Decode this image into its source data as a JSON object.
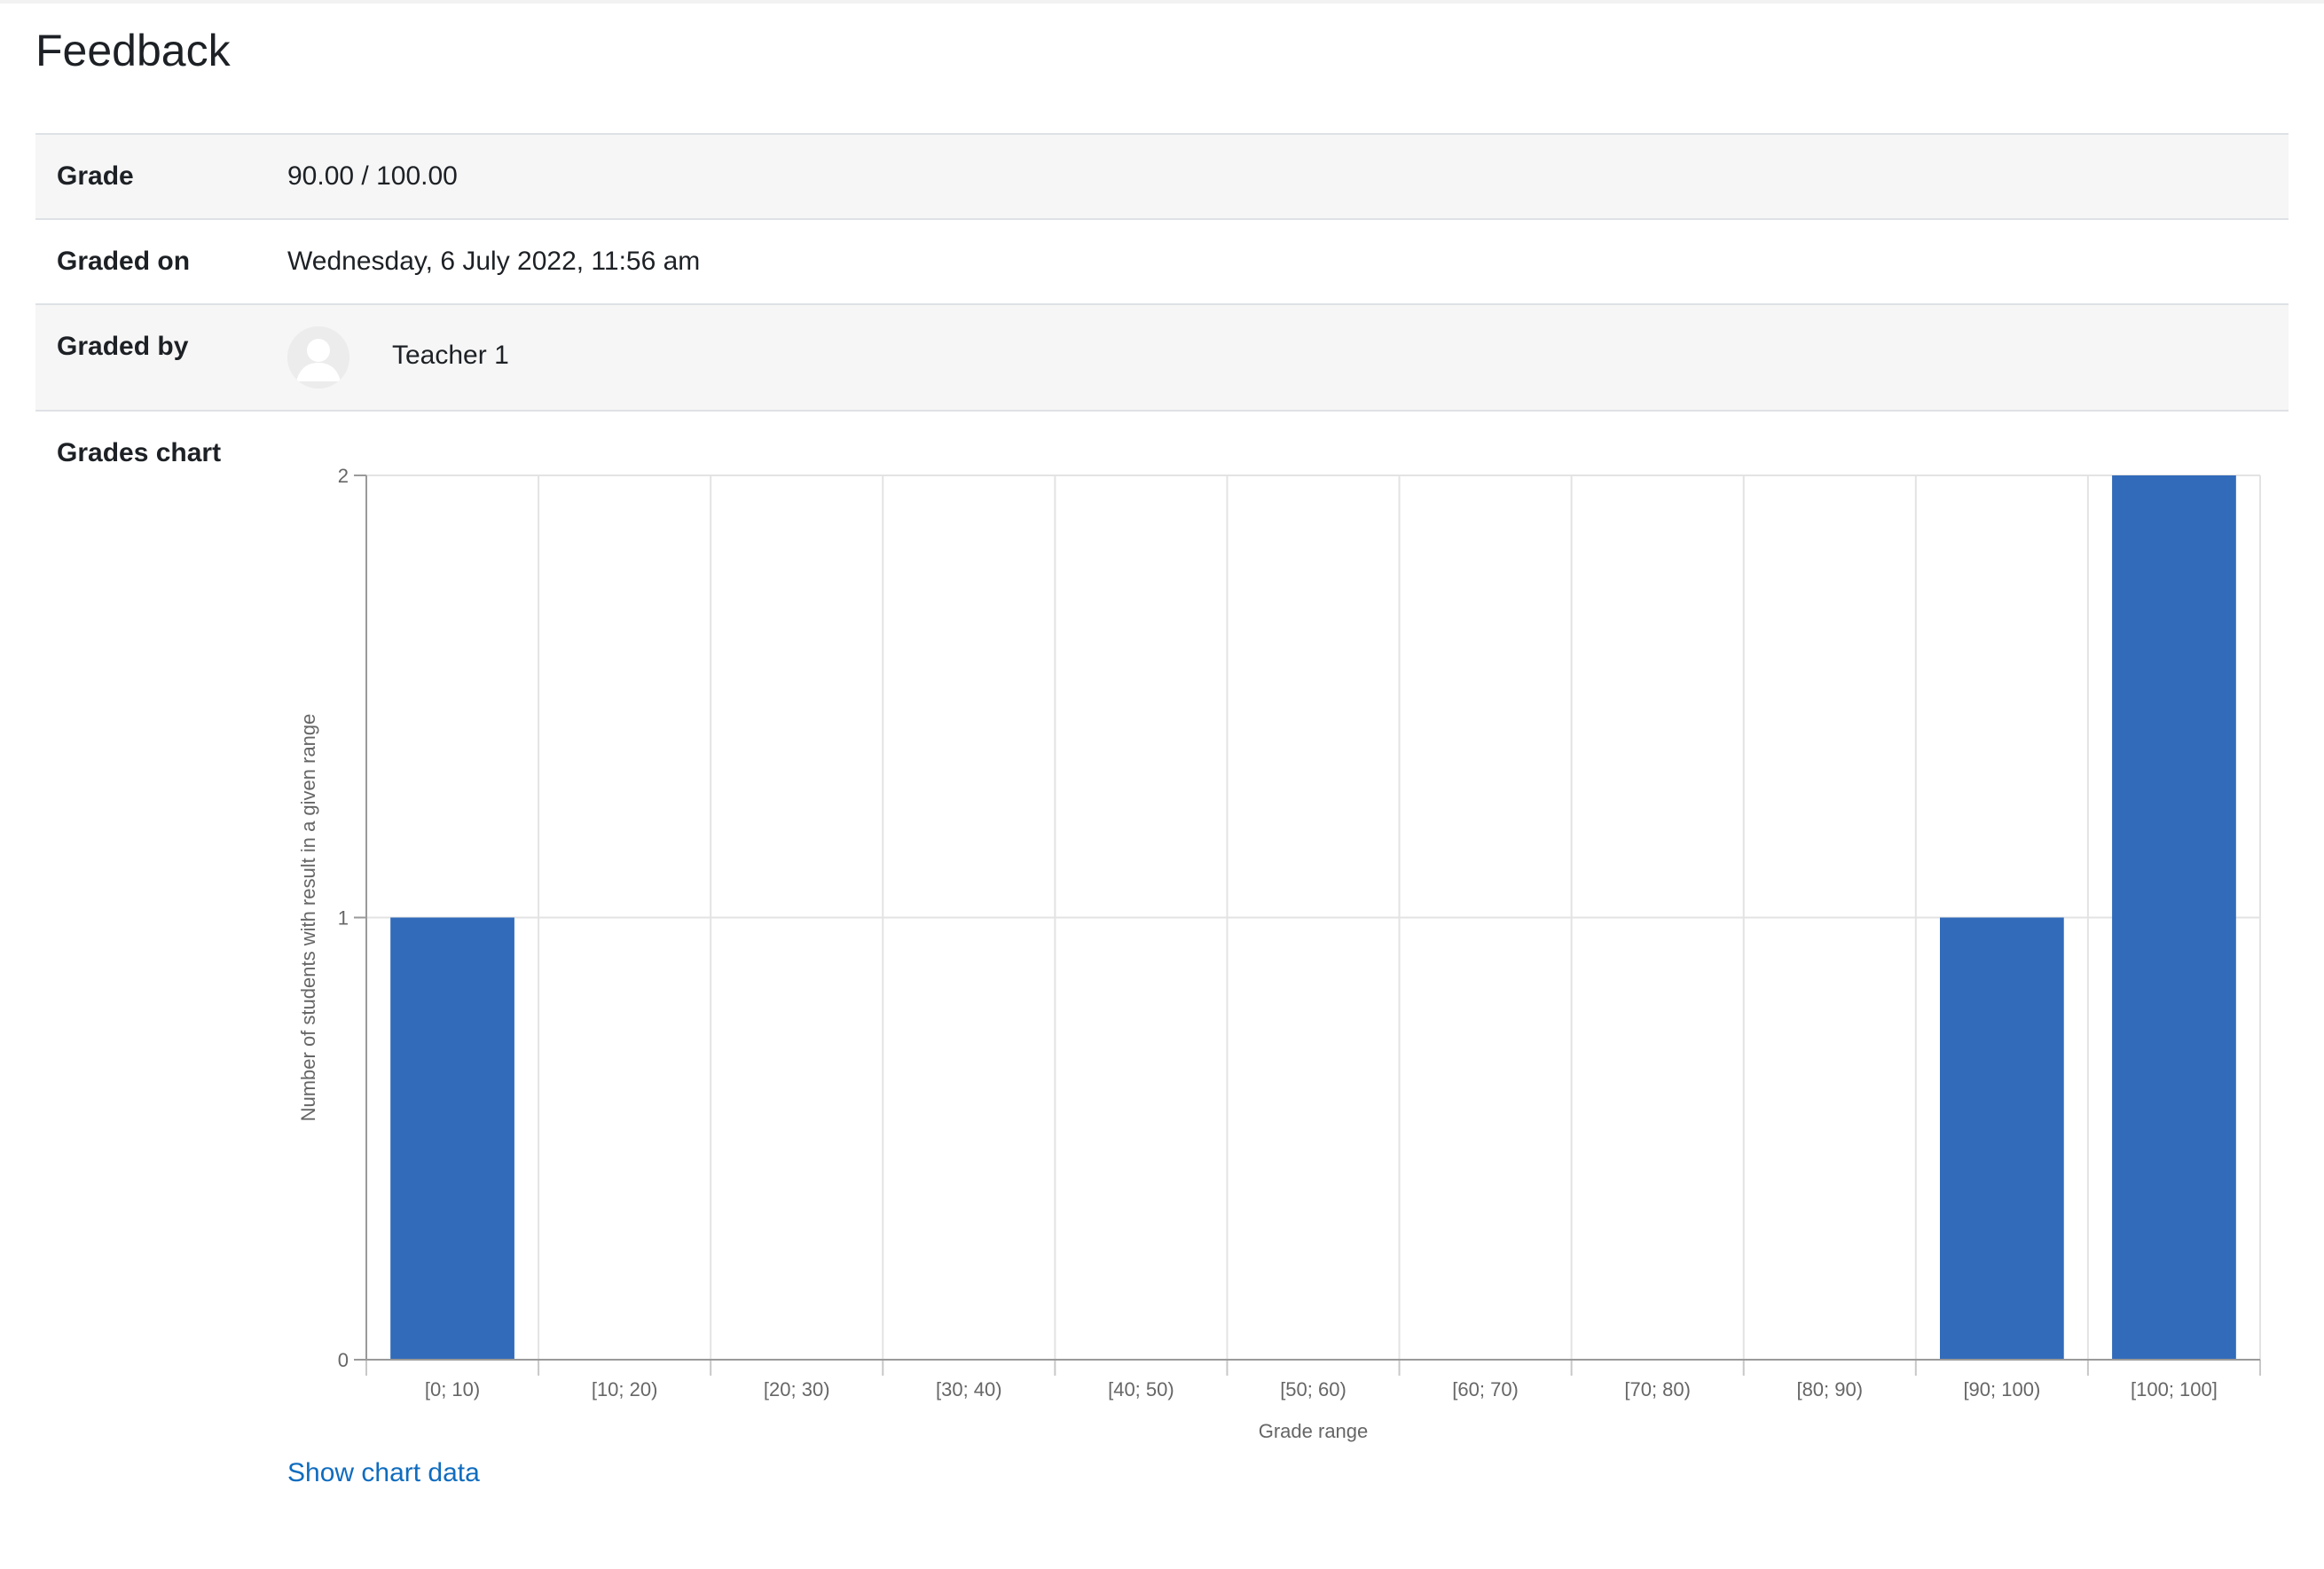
{
  "page": {
    "title": "Feedback"
  },
  "feedback": {
    "grade_label": "Grade",
    "grade_value": "90.00 / 100.00",
    "graded_on_label": "Graded on",
    "graded_on_value": "Wednesday, 6 July 2022, 11:56 am",
    "graded_by_label": "Graded by",
    "graded_by_name": "Teacher 1",
    "grades_chart_label": "Grades chart",
    "show_chart_data": "Show chart data"
  },
  "chart_data": {
    "type": "bar",
    "title": "",
    "xlabel": "Grade range",
    "ylabel": "Number of students with result in a given range",
    "categories": [
      "[0; 10)",
      "[10; 20)",
      "[20; 30)",
      "[30; 40)",
      "[40; 50)",
      "[50; 60)",
      "[60; 70)",
      "[70; 80)",
      "[80; 90)",
      "[90; 100)",
      "[100; 100]"
    ],
    "values": [
      1,
      0,
      0,
      0,
      0,
      0,
      0,
      0,
      0,
      1,
      2
    ],
    "ylim": [
      0,
      2
    ],
    "yticks": [
      0,
      1,
      2
    ],
    "grid": true,
    "bar_color": "#316bba"
  }
}
